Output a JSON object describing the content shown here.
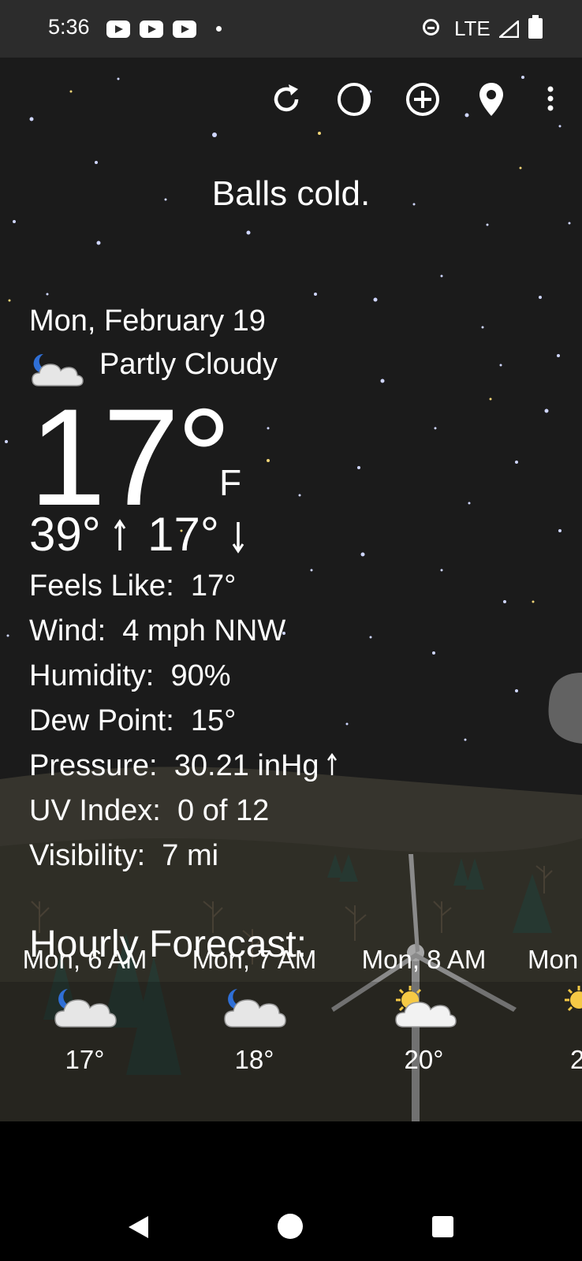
{
  "status_bar": {
    "time": "5:36",
    "notification_icons": [
      "youtube-icon",
      "youtube-icon",
      "youtube-icon",
      "dot-icon"
    ],
    "network": "LTE",
    "right_icons": [
      "do-not-disturb-icon",
      "signal-icon",
      "battery-icon"
    ]
  },
  "toolbar": {
    "buttons": [
      "refresh-icon",
      "theme-icon",
      "add-location-icon",
      "location-pin-icon",
      "more-vert-icon"
    ]
  },
  "tagline": "Balls cold.",
  "current": {
    "date": "Mon, February 19",
    "condition": "Partly Cloudy",
    "condition_icon": "partly-cloudy-night-icon",
    "temp": "17°",
    "unit": "F",
    "high": "39°",
    "low": "17°",
    "details": [
      {
        "label": "Feels Like:",
        "value": "17°"
      },
      {
        "label": "Wind:",
        "value": "4 mph NNW"
      },
      {
        "label": "Humidity:",
        "value": "90%"
      },
      {
        "label": "Dew Point:",
        "value": "15°"
      },
      {
        "label": "Pressure:",
        "value": "30.21 inHg"
      },
      {
        "label": "UV Index:",
        "value": "0 of 12"
      },
      {
        "label": "Visibility:",
        "value": "7 mi"
      }
    ]
  },
  "hourly": {
    "title": "Hourly Forecast:",
    "items": [
      {
        "time": "Mon, 6 AM",
        "icon": "partly-cloudy-night-icon",
        "temp": "17°"
      },
      {
        "time": "Mon, 7 AM",
        "icon": "partly-cloudy-night-icon",
        "temp": "18°"
      },
      {
        "time": "Mon, 8 AM",
        "icon": "partly-sunny-icon",
        "temp": "20°"
      },
      {
        "time": "Mon",
        "icon": "partly-sunny-icon",
        "temp": "2"
      }
    ]
  },
  "colors": {
    "sky": "#1b1b1b",
    "status_bar": "#2c2c2c",
    "sun": "#f6c945",
    "moon": "#2f6fd6"
  }
}
